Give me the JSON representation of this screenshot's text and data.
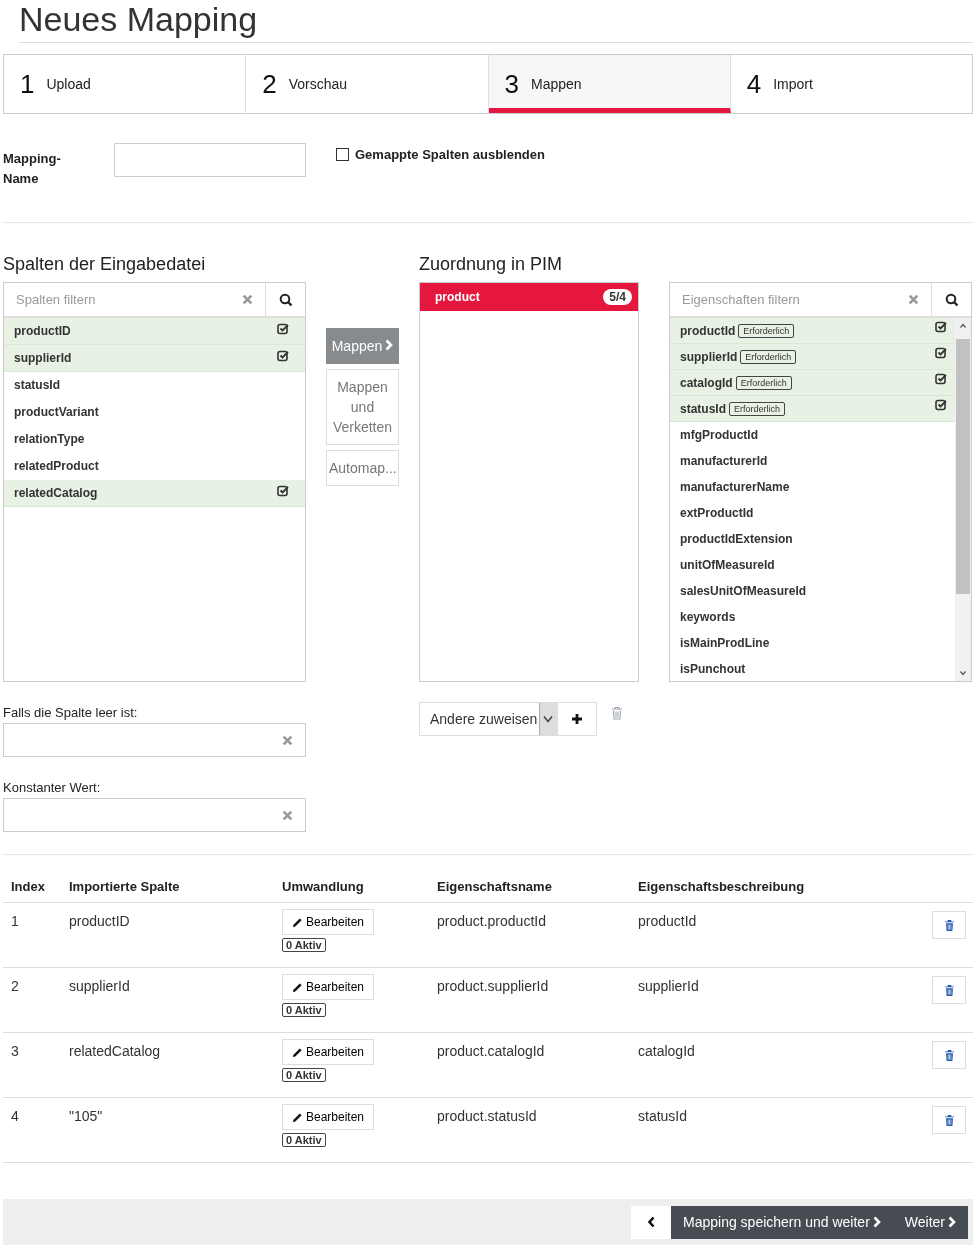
{
  "title": "Neues Mapping",
  "steps": [
    {
      "number": "1",
      "label": "Upload",
      "selected": false
    },
    {
      "number": "2",
      "label": "Vorschau",
      "selected": false
    },
    {
      "number": "3",
      "label": "Mappen",
      "selected": true
    },
    {
      "number": "4",
      "label": "Import",
      "selected": false
    }
  ],
  "mapping_name": {
    "label": "Mapping-Name"
  },
  "hide_mapped": {
    "label": "Gemappte Spalten ausblenden",
    "checked": false
  },
  "source": {
    "title": "Spalten der Eingabedatei",
    "placeholder": "Spalten filtern",
    "items": [
      {
        "name": "productID",
        "mapped": true
      },
      {
        "name": "supplierId",
        "mapped": true
      },
      {
        "name": "statusId",
        "mapped": false
      },
      {
        "name": "productVariant",
        "mapped": false
      },
      {
        "name": "relationType",
        "mapped": false
      },
      {
        "name": "relatedProduct",
        "mapped": false
      },
      {
        "name": "relatedCatalog",
        "mapped": true
      }
    ]
  },
  "actions": [
    {
      "label": "Mappen",
      "primary": true
    },
    {
      "label": "Mappen und Verketten",
      "primary": false
    },
    {
      "label": "Automap...",
      "primary": false
    }
  ],
  "target": {
    "title": "Zuordnung in PIM",
    "groups": [
      {
        "name": "product",
        "count": "5/4",
        "selected": true
      }
    ]
  },
  "properties": {
    "placeholder": "Eigenschaften filtern",
    "items": [
      {
        "name": "productId",
        "badge": "Erforderlich",
        "mapped": true
      },
      {
        "name": "supplierId",
        "badge": "Erforderlich",
        "mapped": true
      },
      {
        "name": "catalogId",
        "badge": "Erforderlich",
        "mapped": true
      },
      {
        "name": "statusId",
        "badge": "Erforderlich",
        "mapped": true
      },
      {
        "name": "mfgProductId",
        "mapped": false
      },
      {
        "name": "manufacturerId",
        "mapped": false
      },
      {
        "name": "manufacturerName",
        "mapped": false
      },
      {
        "name": "extProductId",
        "mapped": false
      },
      {
        "name": "productIdExtension",
        "mapped": false
      },
      {
        "name": "unitOfMeasureId",
        "mapped": false
      },
      {
        "name": "salesUnitOfMeasureId",
        "mapped": false
      },
      {
        "name": "keywords",
        "mapped": false
      },
      {
        "name": "isMainProdLine",
        "mapped": false
      },
      {
        "name": "isPunchout",
        "mapped": false
      }
    ]
  },
  "empty_value": {
    "label": "Falls die Spalte leer ist:"
  },
  "constant": {
    "label": "Konstanter Wert:"
  },
  "assign": {
    "value": "Andere zuweisen"
  },
  "table": {
    "columns": [
      "Index",
      "Importierte Spalte",
      "Umwandlung",
      "Eigenschaftsname",
      "Eigenschaftsbeschreibung"
    ],
    "rows": [
      {
        "index": "1",
        "column": "productID",
        "edit": "Bearbeiten",
        "active": "0 Aktiv",
        "property": "product.productId",
        "description": "productId"
      },
      {
        "index": "2",
        "column": "supplierId",
        "edit": "Bearbeiten",
        "active": "0 Aktiv",
        "property": "product.supplierId",
        "description": "supplierId"
      },
      {
        "index": "3",
        "column": "relatedCatalog",
        "edit": "Bearbeiten",
        "active": "0 Aktiv",
        "property": "product.catalogId",
        "description": "catalogId"
      },
      {
        "index": "4",
        "column": "\"105\"",
        "edit": "Bearbeiten",
        "active": "0 Aktiv",
        "property": "product.statusId",
        "description": "statusId"
      }
    ]
  },
  "footer": {
    "save": "Mapping speichern und weiter",
    "next": "Weiter"
  }
}
